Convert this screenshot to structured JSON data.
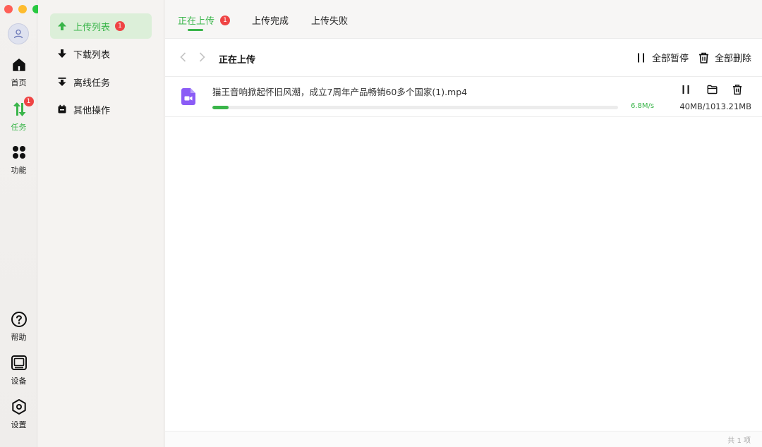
{
  "colors": {
    "accent": "#3ab54a",
    "badge": "#ef4444"
  },
  "rail": {
    "items": [
      {
        "label": "首页",
        "icon": "home-icon"
      },
      {
        "label": "任务",
        "icon": "transfer-icon",
        "badge": "1"
      },
      {
        "label": "功能",
        "icon": "grid-icon"
      },
      {
        "label": "帮助",
        "icon": "help-icon"
      },
      {
        "label": "设备",
        "icon": "device-icon"
      },
      {
        "label": "设置",
        "icon": "settings-icon"
      }
    ]
  },
  "sidebar": {
    "items": [
      {
        "label": "上传列表",
        "icon": "upload-arrow-icon",
        "badge": "1"
      },
      {
        "label": "下载列表",
        "icon": "download-arrow-icon"
      },
      {
        "label": "离线任务",
        "icon": "offline-download-icon"
      },
      {
        "label": "其他操作",
        "icon": "calendar-icon"
      }
    ]
  },
  "tabs": [
    {
      "label": "正在上传",
      "badge": "1"
    },
    {
      "label": "上传完成"
    },
    {
      "label": "上传失败"
    }
  ],
  "toolbar": {
    "title": "正在上传",
    "pause_all": "全部暂停",
    "delete_all": "全部删除"
  },
  "uploads": [
    {
      "name": "猫王音响掀起怀旧风潮，成立7周年产品畅销60多个国家(1).mp4",
      "speed": "6.8M/s",
      "size": "40MB/1013.21MB",
      "progress": 0.04,
      "icon": "video-file-icon"
    }
  ],
  "footer": {
    "count": "共 1 项"
  }
}
